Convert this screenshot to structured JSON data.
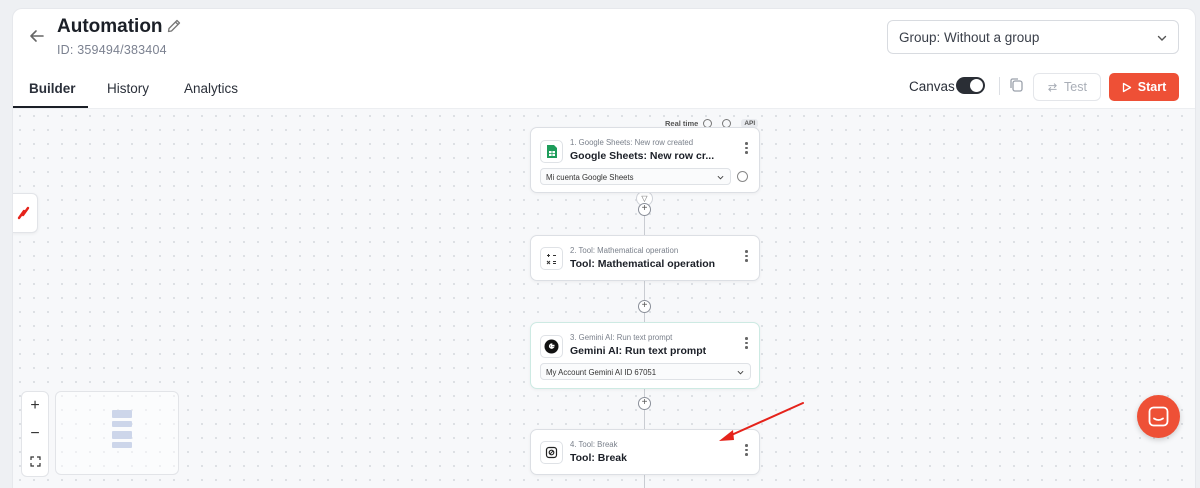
{
  "header": {
    "title": "Automation",
    "id_text": "ID: 359494/383404",
    "group_select": "Group: Without a group"
  },
  "tabs": [
    {
      "label": "Builder",
      "active": true
    },
    {
      "label": "History",
      "active": false
    },
    {
      "label": "Analytics",
      "active": false
    }
  ],
  "toolbar": {
    "canvas_label": "Canvas",
    "canvas_toggle_on": true,
    "test_label": "Test",
    "start_label": "Start"
  },
  "trigger_badges": {
    "realtime_label": "Real time",
    "api_label": "API"
  },
  "nodes": [
    {
      "step": "1. Google Sheets: New row created",
      "name": "Google Sheets: New row cr...",
      "account": "Mi cuenta Google Sheets",
      "icon": "google-sheets-icon"
    },
    {
      "step": "2. Tool: Mathematical operation",
      "name": "Tool: Mathematical operation",
      "icon": "math-operation-icon"
    },
    {
      "step": "3. Gemini AI: Run text prompt",
      "name": "Gemini AI: Run text prompt",
      "account": "My Account Gemini AI ID 67051",
      "icon": "gemini-icon"
    },
    {
      "step": "4. Tool: Break",
      "name": "Tool: Break",
      "icon": "break-icon"
    }
  ],
  "colors": {
    "accent": "#ee5036",
    "toggle": "#2a2e35",
    "annotation_arrow": "#e5231b"
  }
}
